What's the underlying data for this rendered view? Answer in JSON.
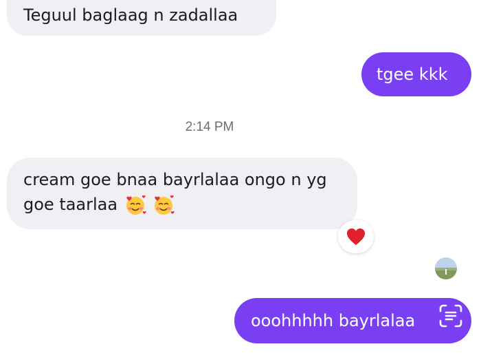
{
  "messages": {
    "m1_text": "Teguul baglaag n zadallaa",
    "m2_text": "tgee kkk",
    "timestamp": "2:14 PM",
    "m3_line1": "cream goe bnaa bayrlalaa ongo n yg",
    "m3_line2": "goe taarlaa",
    "m3_emojis": [
      "smiling-face-with-hearts-icon",
      "smiling-face-with-hearts-icon"
    ],
    "m3_reaction": "heart-icon",
    "m4_text": "ooohhhhh bayrlalaa"
  },
  "colors": {
    "sent_bubble": "#7a3ff2",
    "received_bubble": "#efeff4",
    "heart": "#e0202c"
  },
  "icons": {
    "avatar": "avatar",
    "overlay": "text-scan-icon"
  }
}
